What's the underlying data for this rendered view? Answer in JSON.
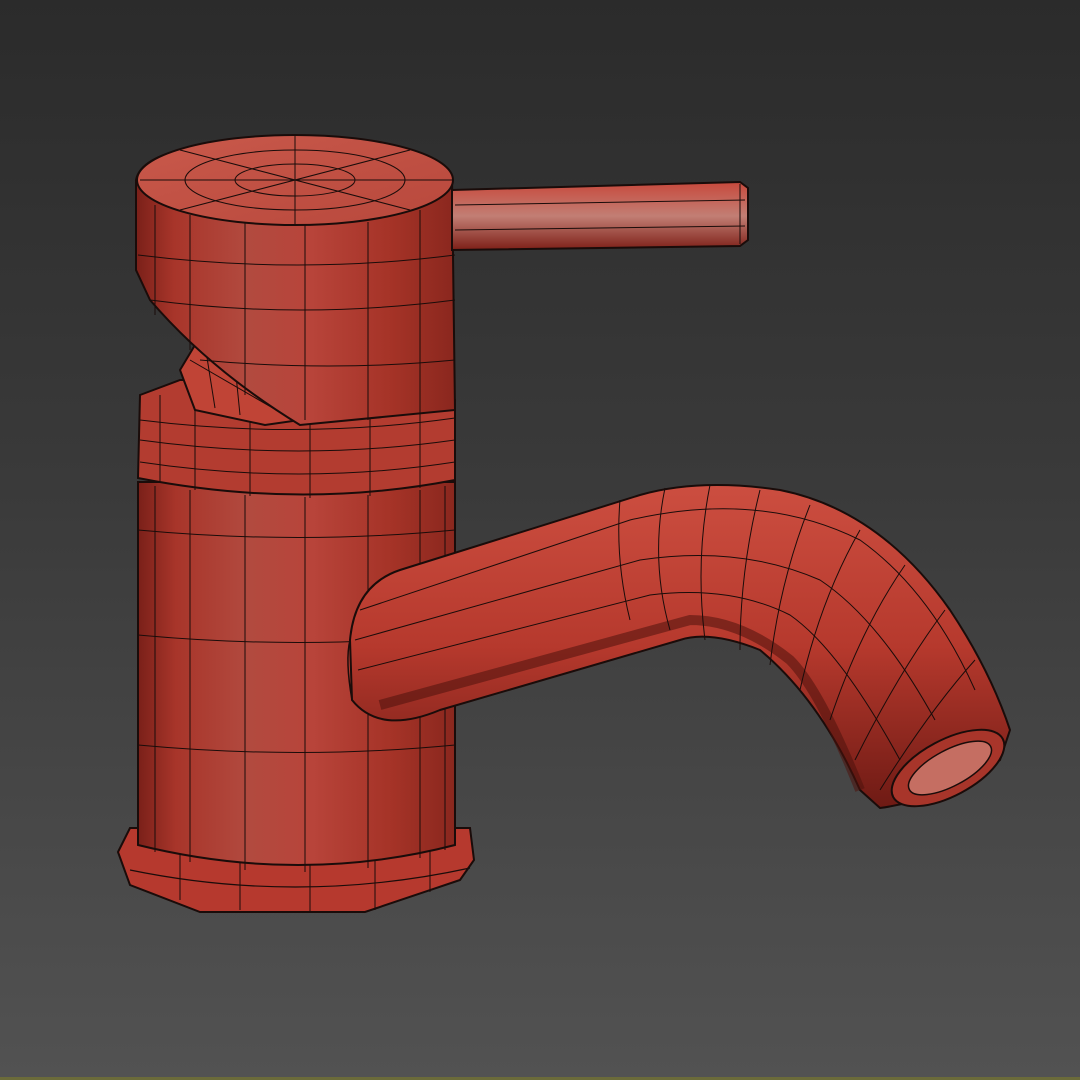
{
  "viewport": {
    "background_top": "#2b2b2b",
    "background_bottom": "#525252"
  },
  "model": {
    "subject": "faucet-icon",
    "base_color": "#c0463a",
    "shadow_color": "#8e2a22",
    "highlight_color": "#d86a5c",
    "wire_color": "#1a0c0a"
  }
}
